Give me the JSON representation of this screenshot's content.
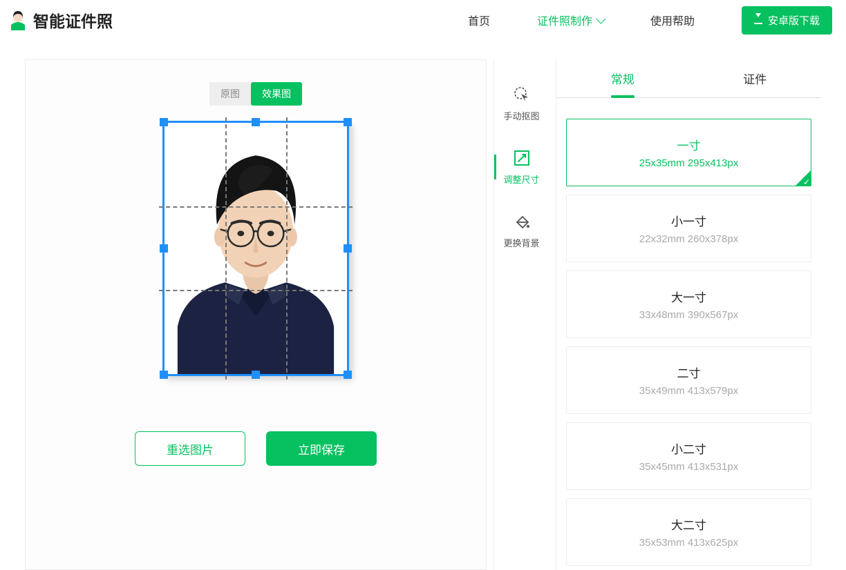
{
  "brand": "智能证件照",
  "nav": {
    "home": "首页",
    "make": "证件照制作",
    "help": "使用帮助",
    "download": "安卓版下载"
  },
  "toggle": {
    "orig": "原图",
    "result": "效果图"
  },
  "actions": {
    "reselect": "重选图片",
    "save": "立即保存"
  },
  "tools": {
    "manual": "手动抠图",
    "resize": "调整尺寸",
    "background": "更换背景"
  },
  "tabs": {
    "regular": "常规",
    "cert": "证件"
  },
  "sizes": [
    {
      "name": "一寸",
      "dim": "25x35mm 295x413px",
      "selected": true
    },
    {
      "name": "小一寸",
      "dim": "22x32mm 260x378px",
      "selected": false
    },
    {
      "name": "大一寸",
      "dim": "33x48mm 390x567px",
      "selected": false
    },
    {
      "name": "二寸",
      "dim": "35x49mm 413x579px",
      "selected": false
    },
    {
      "name": "小二寸",
      "dim": "35x45mm 413x531px",
      "selected": false
    },
    {
      "name": "大二寸",
      "dim": "35x53mm 413x625px",
      "selected": false
    }
  ]
}
